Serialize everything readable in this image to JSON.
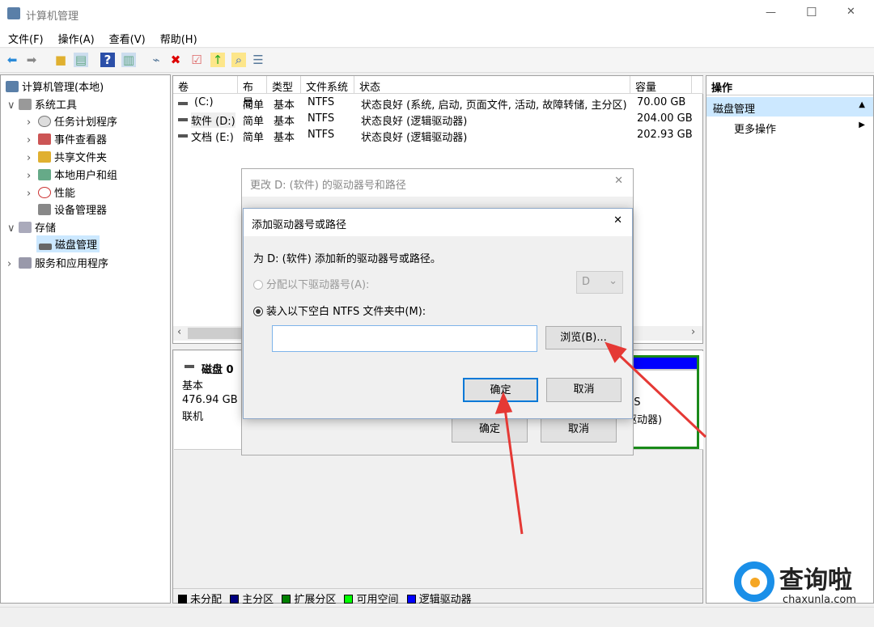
{
  "window": {
    "title": "计算机管理",
    "minimize": "—",
    "maximize": "☐",
    "close": "✕"
  },
  "menu": [
    "文件(F)",
    "操作(A)",
    "查看(V)",
    "帮助(H)"
  ],
  "tree": [
    {
      "label": "计算机管理(本地)",
      "arrow": ""
    },
    {
      "label": "系统工具",
      "arrow": "∨"
    },
    {
      "label": "任务计划程序",
      "arrow": "›"
    },
    {
      "label": "事件查看器",
      "arrow": "›"
    },
    {
      "label": "共享文件夹",
      "arrow": "›"
    },
    {
      "label": "本地用户和组",
      "arrow": "›"
    },
    {
      "label": "性能",
      "arrow": "›"
    },
    {
      "label": "设备管理器",
      "arrow": ""
    },
    {
      "label": "存储",
      "arrow": "∨"
    },
    {
      "label": "磁盘管理",
      "arrow": ""
    },
    {
      "label": "服务和应用程序",
      "arrow": "›"
    }
  ],
  "volumes": {
    "headers": [
      "卷",
      "布局",
      "类型",
      "文件系统",
      "状态",
      "容量"
    ],
    "rows": [
      [
        "(C:)",
        "简单",
        "基本",
        "NTFS",
        "状态良好 (系统, 启动, 页面文件, 活动, 故障转储, 主分区)",
        "70.00 GB"
      ],
      [
        "软件 (D:)",
        "简单",
        "基本",
        "NTFS",
        "状态良好 (逻辑驱动器)",
        "204.00 GB"
      ],
      [
        "文档 (E:)",
        "简单",
        "基本",
        "NTFS",
        "状态良好 (逻辑驱动器)",
        "202.93 GB"
      ]
    ]
  },
  "disk": {
    "name": "磁盘 0",
    "type": "基本",
    "size": "476.94 GB",
    "status": "联机",
    "partial_fs": "FS",
    "partial_status": "驱动器)"
  },
  "legend": [
    {
      "label": "未分配",
      "color": "#000000"
    },
    {
      "label": "主分区",
      "color": "#000080"
    },
    {
      "label": "扩展分区",
      "color": "#008000"
    },
    {
      "label": "可用空间",
      "color": "#00ff00"
    },
    {
      "label": "逻辑驱动器",
      "color": "#0000ff"
    }
  ],
  "actions": {
    "header": "操作",
    "section": "磁盘管理",
    "more": "更多操作"
  },
  "back_dialog": {
    "title": "更改 D: (软件) 的驱动器号和路径",
    "ok": "确定",
    "cancel": "取消"
  },
  "dialog": {
    "title": "添加驱动器号或路径",
    "description": "为 D: (软件) 添加新的驱动器号或路径。",
    "option_letter": "分配以下驱动器号(A):",
    "letter_value": "D",
    "option_folder": "装入以下空白 NTFS 文件夹中(M):",
    "folder_value": "",
    "browse": "浏览(B)...",
    "ok": "确定",
    "cancel": "取消"
  },
  "watermark": {
    "name": "查询啦",
    "url": "chaxunla.com"
  },
  "colors": {
    "accent": "#0078d7",
    "selection": "#cce8ff",
    "arrow": "#e53935"
  }
}
